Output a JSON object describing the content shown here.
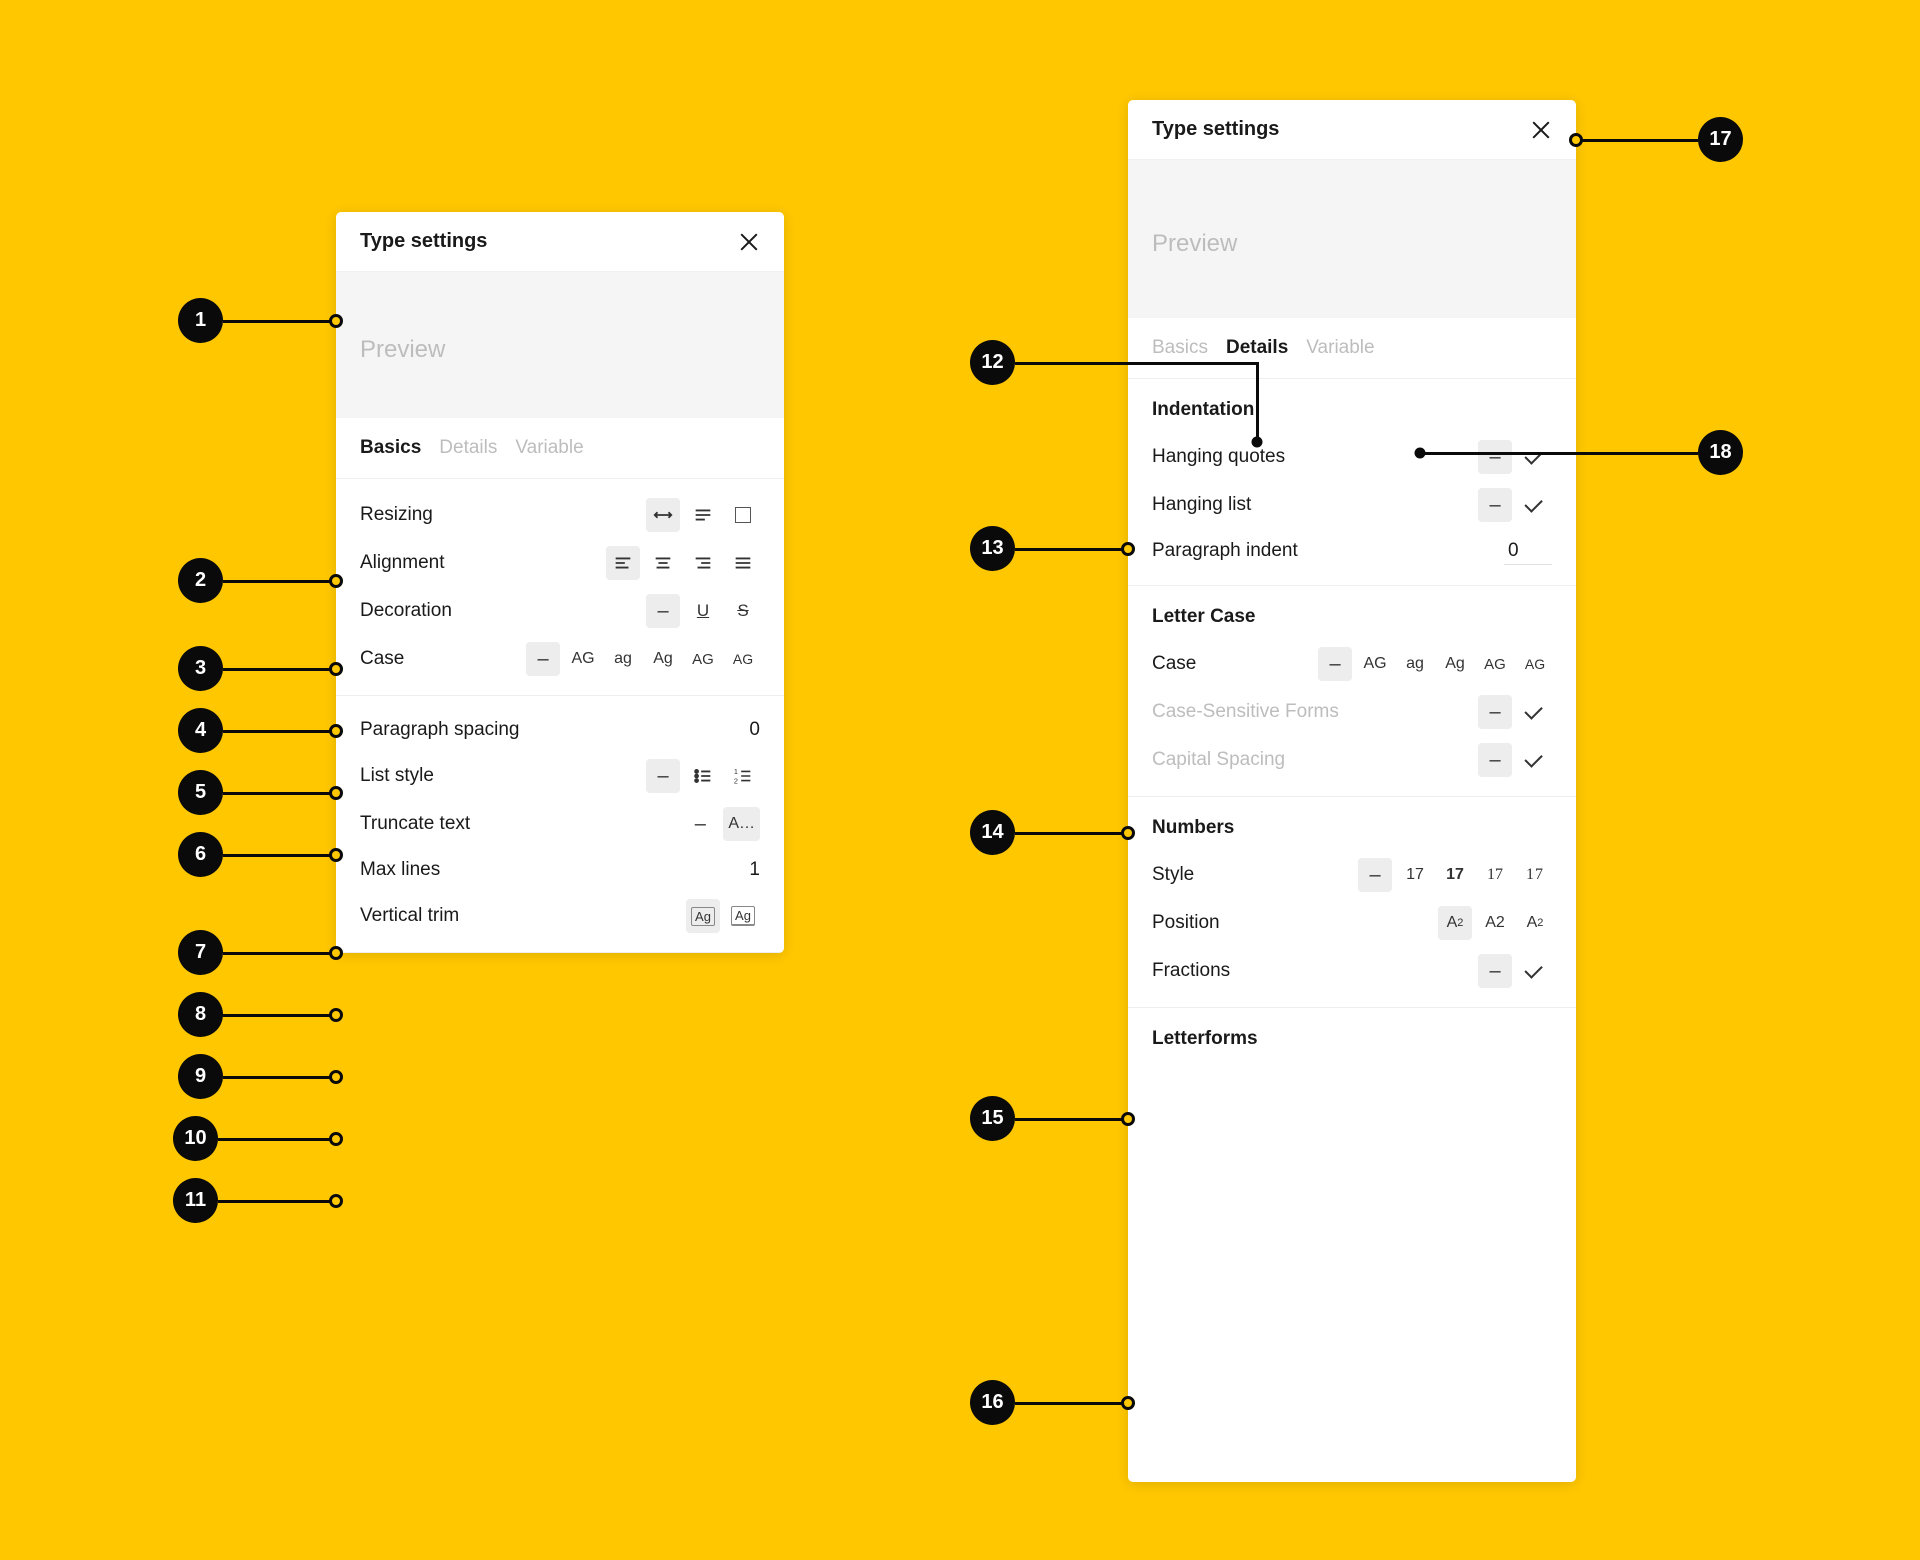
{
  "panel_title": "Type settings",
  "preview_label": "Preview",
  "tabs": {
    "basics": "Basics",
    "details": "Details",
    "variable": "Variable"
  },
  "basics": {
    "resizing_label": "Resizing",
    "alignment_label": "Alignment",
    "decoration_label": "Decoration",
    "case_label": "Case",
    "paragraph_spacing_label": "Paragraph spacing",
    "paragraph_spacing_value": "0",
    "list_style_label": "List style",
    "truncate_label": "Truncate text",
    "max_lines_label": "Max lines",
    "max_lines_value": "1",
    "vertical_trim_label": "Vertical trim",
    "case_opts": {
      "dash": "–",
      "ag_upper": "AG",
      "ag_lower": "ag",
      "ag_title": "Ag",
      "ag_sc1": "AG",
      "ag_sc2": "AG"
    },
    "truncate_opts": {
      "dash": "–",
      "trunc": "A…"
    },
    "decoration_opts": {
      "dash": "–",
      "underline": "U",
      "strike": "S"
    },
    "vtrim_opts": {
      "a": "Ag",
      "b": "Ag"
    }
  },
  "details": {
    "indent_title": "Indentation",
    "hanging_quotes_label": "Hanging quotes",
    "hanging_list_label": "Hanging list",
    "paragraph_indent_label": "Paragraph indent",
    "paragraph_indent_value": "0",
    "letter_case_title": "Letter Case",
    "case_label": "Case",
    "case_sensitive_label": "Case-Sensitive Forms",
    "capital_spacing_label": "Capital Spacing",
    "numbers_title": "Numbers",
    "style_label": "Style",
    "position_label": "Position",
    "fractions_label": "Fractions",
    "letterforms_title": "Letterforms",
    "dash": "–",
    "case_opts": {
      "ag_upper": "AG",
      "ag_lower": "ag",
      "ag_title": "Ag",
      "ag_sc1": "AG",
      "ag_sc2": "AG"
    },
    "num_style": {
      "a": "17",
      "b": "17",
      "c": "17",
      "d": "17"
    },
    "num_pos": {
      "a": "A",
      "a2": "2",
      "b": "A2",
      "c": "A",
      "c2": "2"
    }
  },
  "annotations": {
    "1": "1",
    "2": "2",
    "3": "3",
    "4": "4",
    "5": "5",
    "6": "6",
    "7": "7",
    "8": "8",
    "9": "9",
    "10": "10",
    "11": "11",
    "12": "12",
    "13": "13",
    "14": "14",
    "15": "15",
    "16": "16",
    "17": "17",
    "18": "18"
  }
}
